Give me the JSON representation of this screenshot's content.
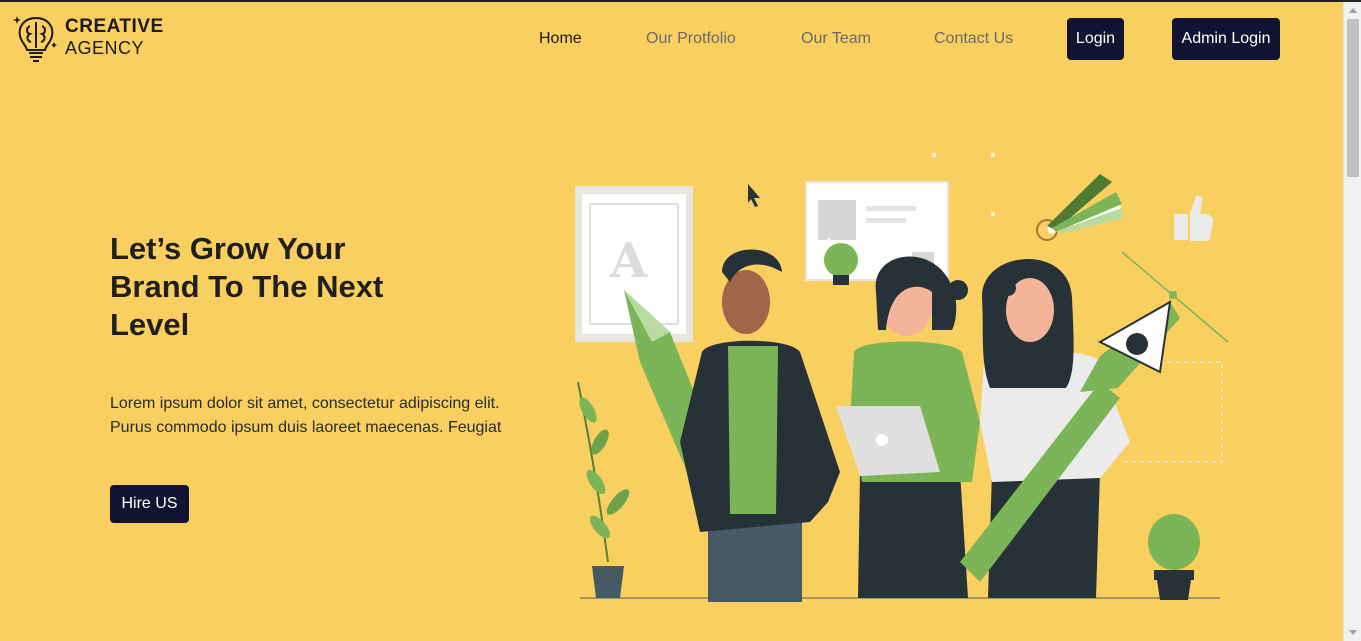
{
  "brand": {
    "line1": "CREATIVE",
    "line2": "AGENCY"
  },
  "nav": {
    "items": [
      {
        "label": "Home",
        "active": true
      },
      {
        "label": "Our Protfolio",
        "active": false
      },
      {
        "label": "Our Team",
        "active": false
      },
      {
        "label": "Contact Us",
        "active": false
      }
    ],
    "login_label": "Login",
    "admin_login_label": "Admin Login"
  },
  "hero": {
    "title": "Let’s Grow Your Brand To The Next Level",
    "body_line1": "Lorem ipsum dolor sit amet, consectetur adipiscing elit.",
    "body_line2": "Purus commodo ipsum duis laoreet maecenas. Feugiat",
    "cta_label": "Hire US",
    "illustration_letter": "A"
  },
  "colors": {
    "background": "#f9cf60",
    "button_dark": "#111430",
    "illustration_green": "#7cb557",
    "illustration_dark": "#263238"
  }
}
